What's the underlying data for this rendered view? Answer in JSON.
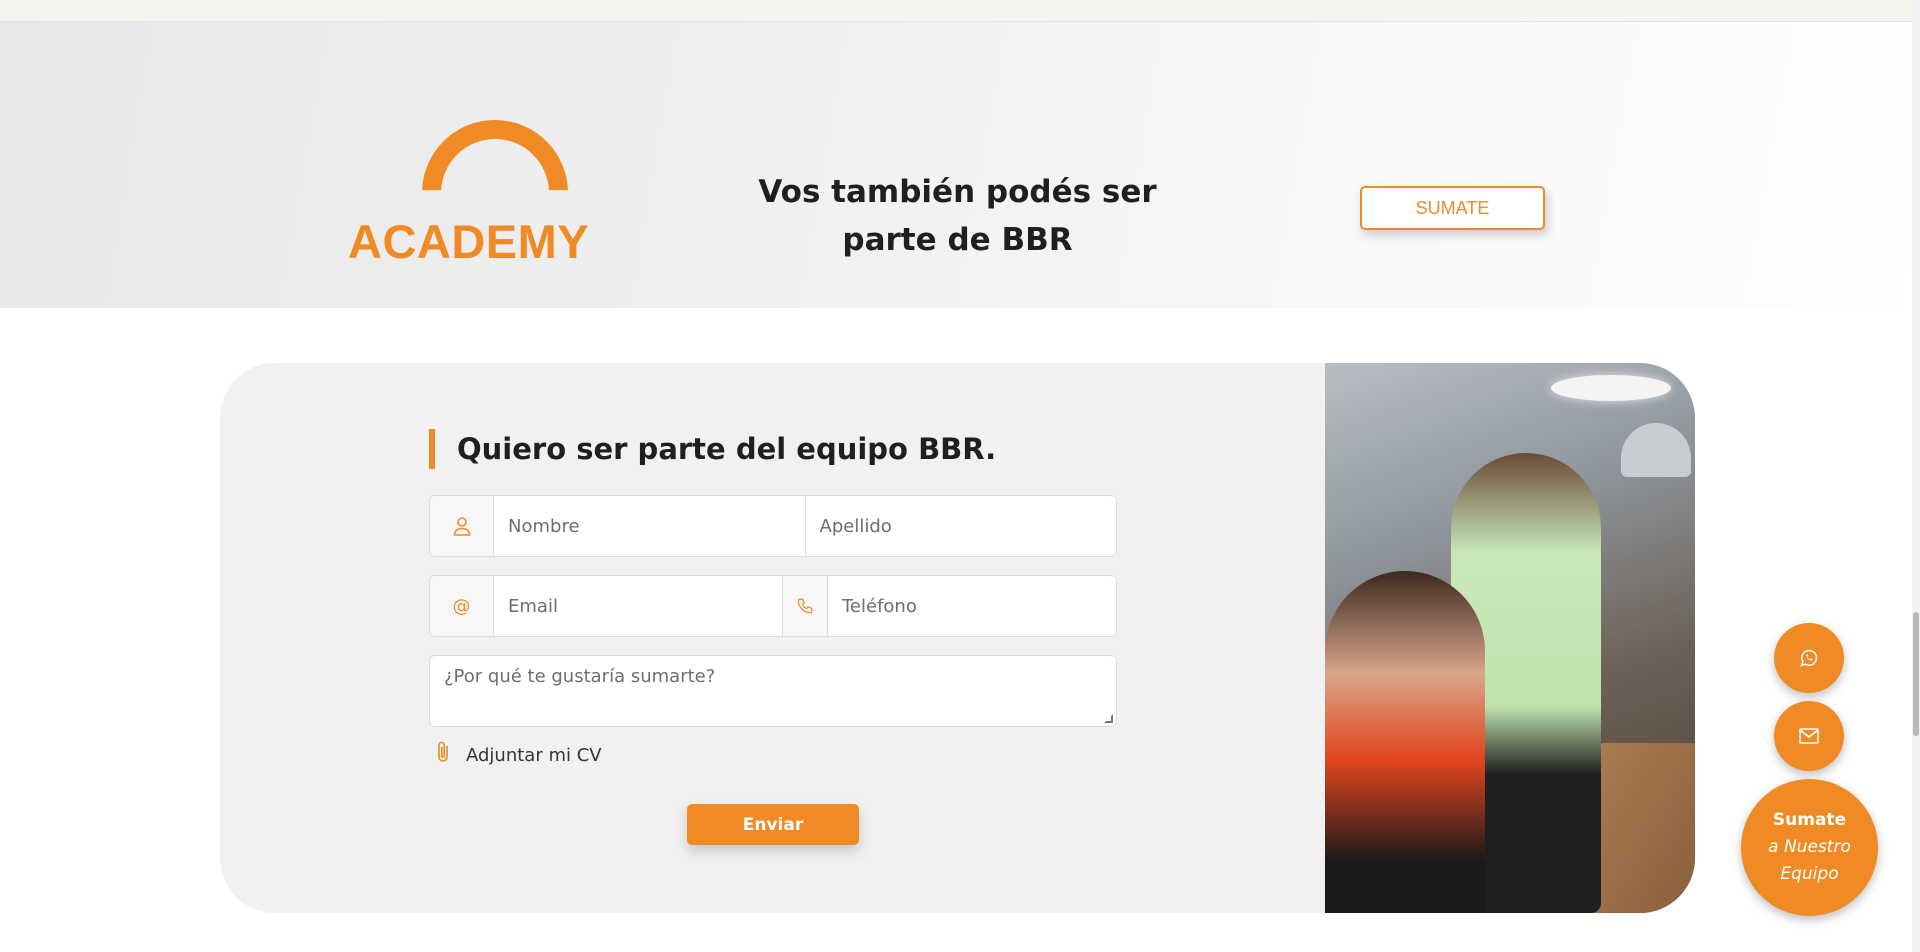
{
  "banner": {
    "logo_text": "ACADEMY",
    "headline_line1": "Vos también podés ser",
    "headline_line2": "parte de BBR",
    "button_label": "SUMATE"
  },
  "form": {
    "title": "Quiero ser parte del equipo BBR.",
    "nombre_placeholder": "Nombre",
    "apellido_placeholder": "Apellido",
    "email_placeholder": "Email",
    "telefono_placeholder": "Teléfono",
    "message_placeholder": "¿Por qué te gustaría sumarte?",
    "attach_label": "Adjuntar mi CV",
    "submit_label": "Enviar",
    "icons": {
      "name": "person-icon",
      "email": "at-sign-icon",
      "phone": "phone-icon",
      "attach": "paperclip-icon"
    }
  },
  "floating": {
    "icons": [
      "whatsapp-icon",
      "mail-icon"
    ],
    "join_line1": "Sumate",
    "join_line2": "a Nuestro",
    "join_line3": "Equipo"
  },
  "colors": {
    "accent": "#f08a24",
    "text": "#1e1f23",
    "card_bg": "#f1f1f1"
  }
}
